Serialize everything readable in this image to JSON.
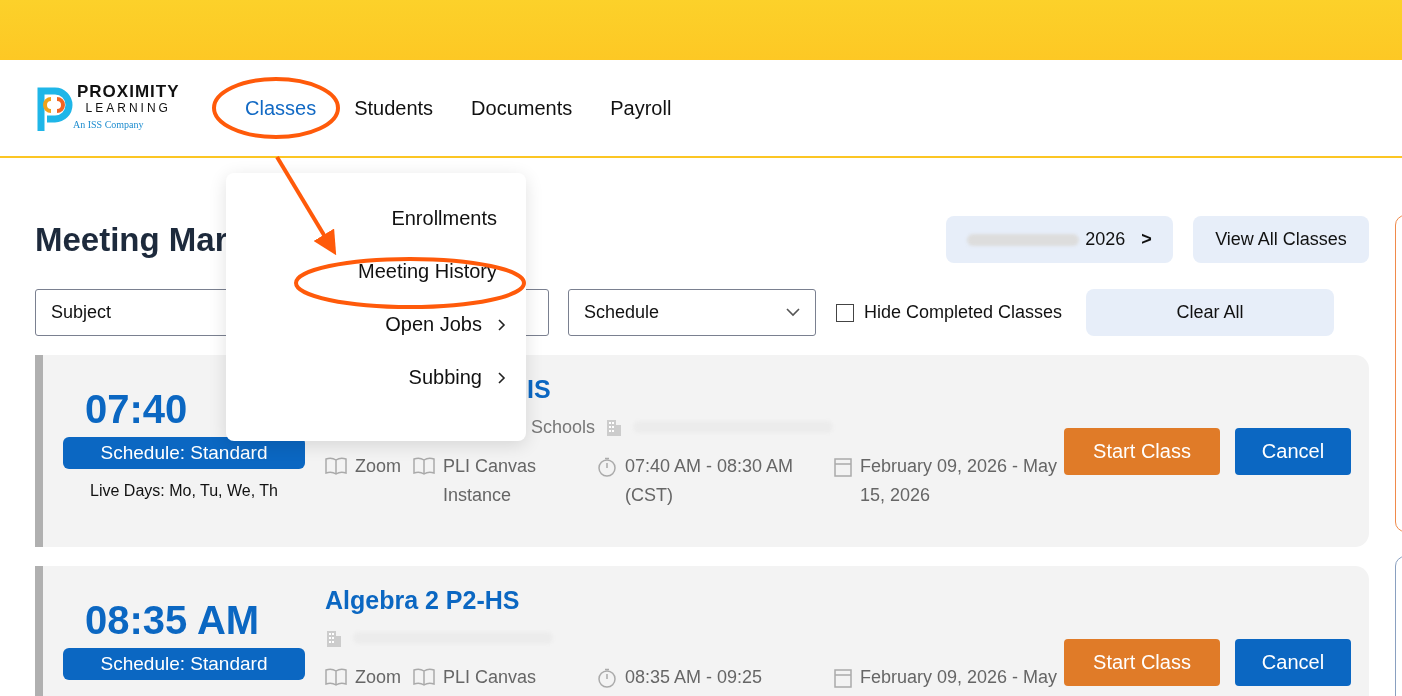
{
  "logo": {
    "name_line_1": "PROXIMITY",
    "name_line_2": "LEARNING",
    "tagline": "An ISS Company"
  },
  "nav": [
    {
      "label": "Classes",
      "selected": true
    },
    {
      "label": "Students",
      "selected": false
    },
    {
      "label": "Documents",
      "selected": false
    },
    {
      "label": "Payroll",
      "selected": false
    }
  ],
  "classes_menu": [
    {
      "label": "Enrollments",
      "submenu": false
    },
    {
      "label": "Meeting History",
      "submenu": false
    },
    {
      "label": "Open Jobs",
      "submenu": true
    },
    {
      "label": "Subbing",
      "submenu": true
    }
  ],
  "page_title": "Meeting Mar",
  "date_button": {
    "label": "2026",
    "arrow": ">"
  },
  "view_all_button": "View All Classes",
  "filters": {
    "subject": "Subject",
    "schedule": "Schedule",
    "hide_completed": {
      "label": "Hide Completed Classes",
      "checked": false
    },
    "clear_button": "Clear All"
  },
  "classes": [
    {
      "time": "07:40",
      "schedule": "Schedule: Standard",
      "live_days": "Live Days: Mo, Tu, We, Th",
      "title": "IS",
      "location": "Schools",
      "platform": "Zoom",
      "lms": "PLI Canvas Instance",
      "hours": "07:40 AM - 08:30 AM (CST)",
      "dates": "February 09, 2026 - May 15, 2026",
      "start_button": "Start Class",
      "cancel_button": "Cancel"
    },
    {
      "time": "08:35 AM",
      "schedule": "Schedule: Standard",
      "title": "Algebra 2 P2-HS",
      "platform": "Zoom",
      "lms": "PLI Canvas",
      "hours": "08:35 AM - 09:25",
      "dates": "February 09, 2026 - May",
      "start_button": "Start Class",
      "cancel_button": "Cancel"
    }
  ]
}
